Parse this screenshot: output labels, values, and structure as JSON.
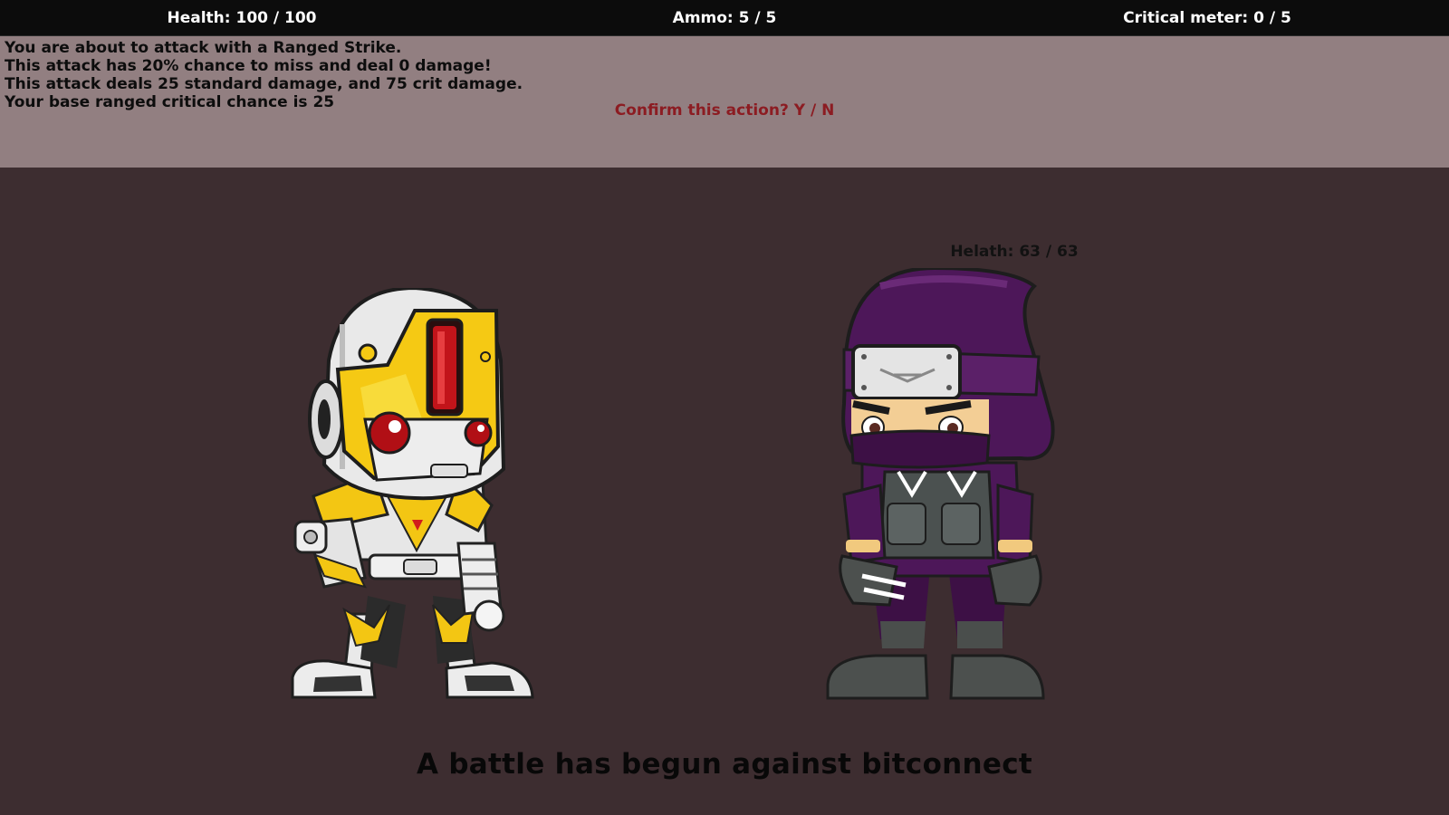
{
  "hud": {
    "health": "Health: 100 / 100",
    "ammo": "Ammo: 5 / 5",
    "critical_meter": "Critical meter: 0 / 5"
  },
  "info_panel": {
    "lines": [
      "You are about to attack with a Ranged Strike.",
      "This attack has 20% chance to miss and deal 0 damage!",
      "This attack deals 25 standard damage, and 75 crit damage.",
      "Your base ranged critical chance is 25"
    ],
    "confirm_prompt": "Confirm this action? Y / N"
  },
  "player": {
    "sprite": "robot-knight-icon"
  },
  "enemy": {
    "health_label": "Helath: 63 / 63",
    "sprite": "purple-ninja-icon"
  },
  "battle_message": "A battle has begun against bitconnect",
  "colors": {
    "hud_background": "#0c0c0c",
    "info_panel_background": "#927f81",
    "arena_background": "#3d2d30",
    "confirm_text": "#8c1c22"
  }
}
